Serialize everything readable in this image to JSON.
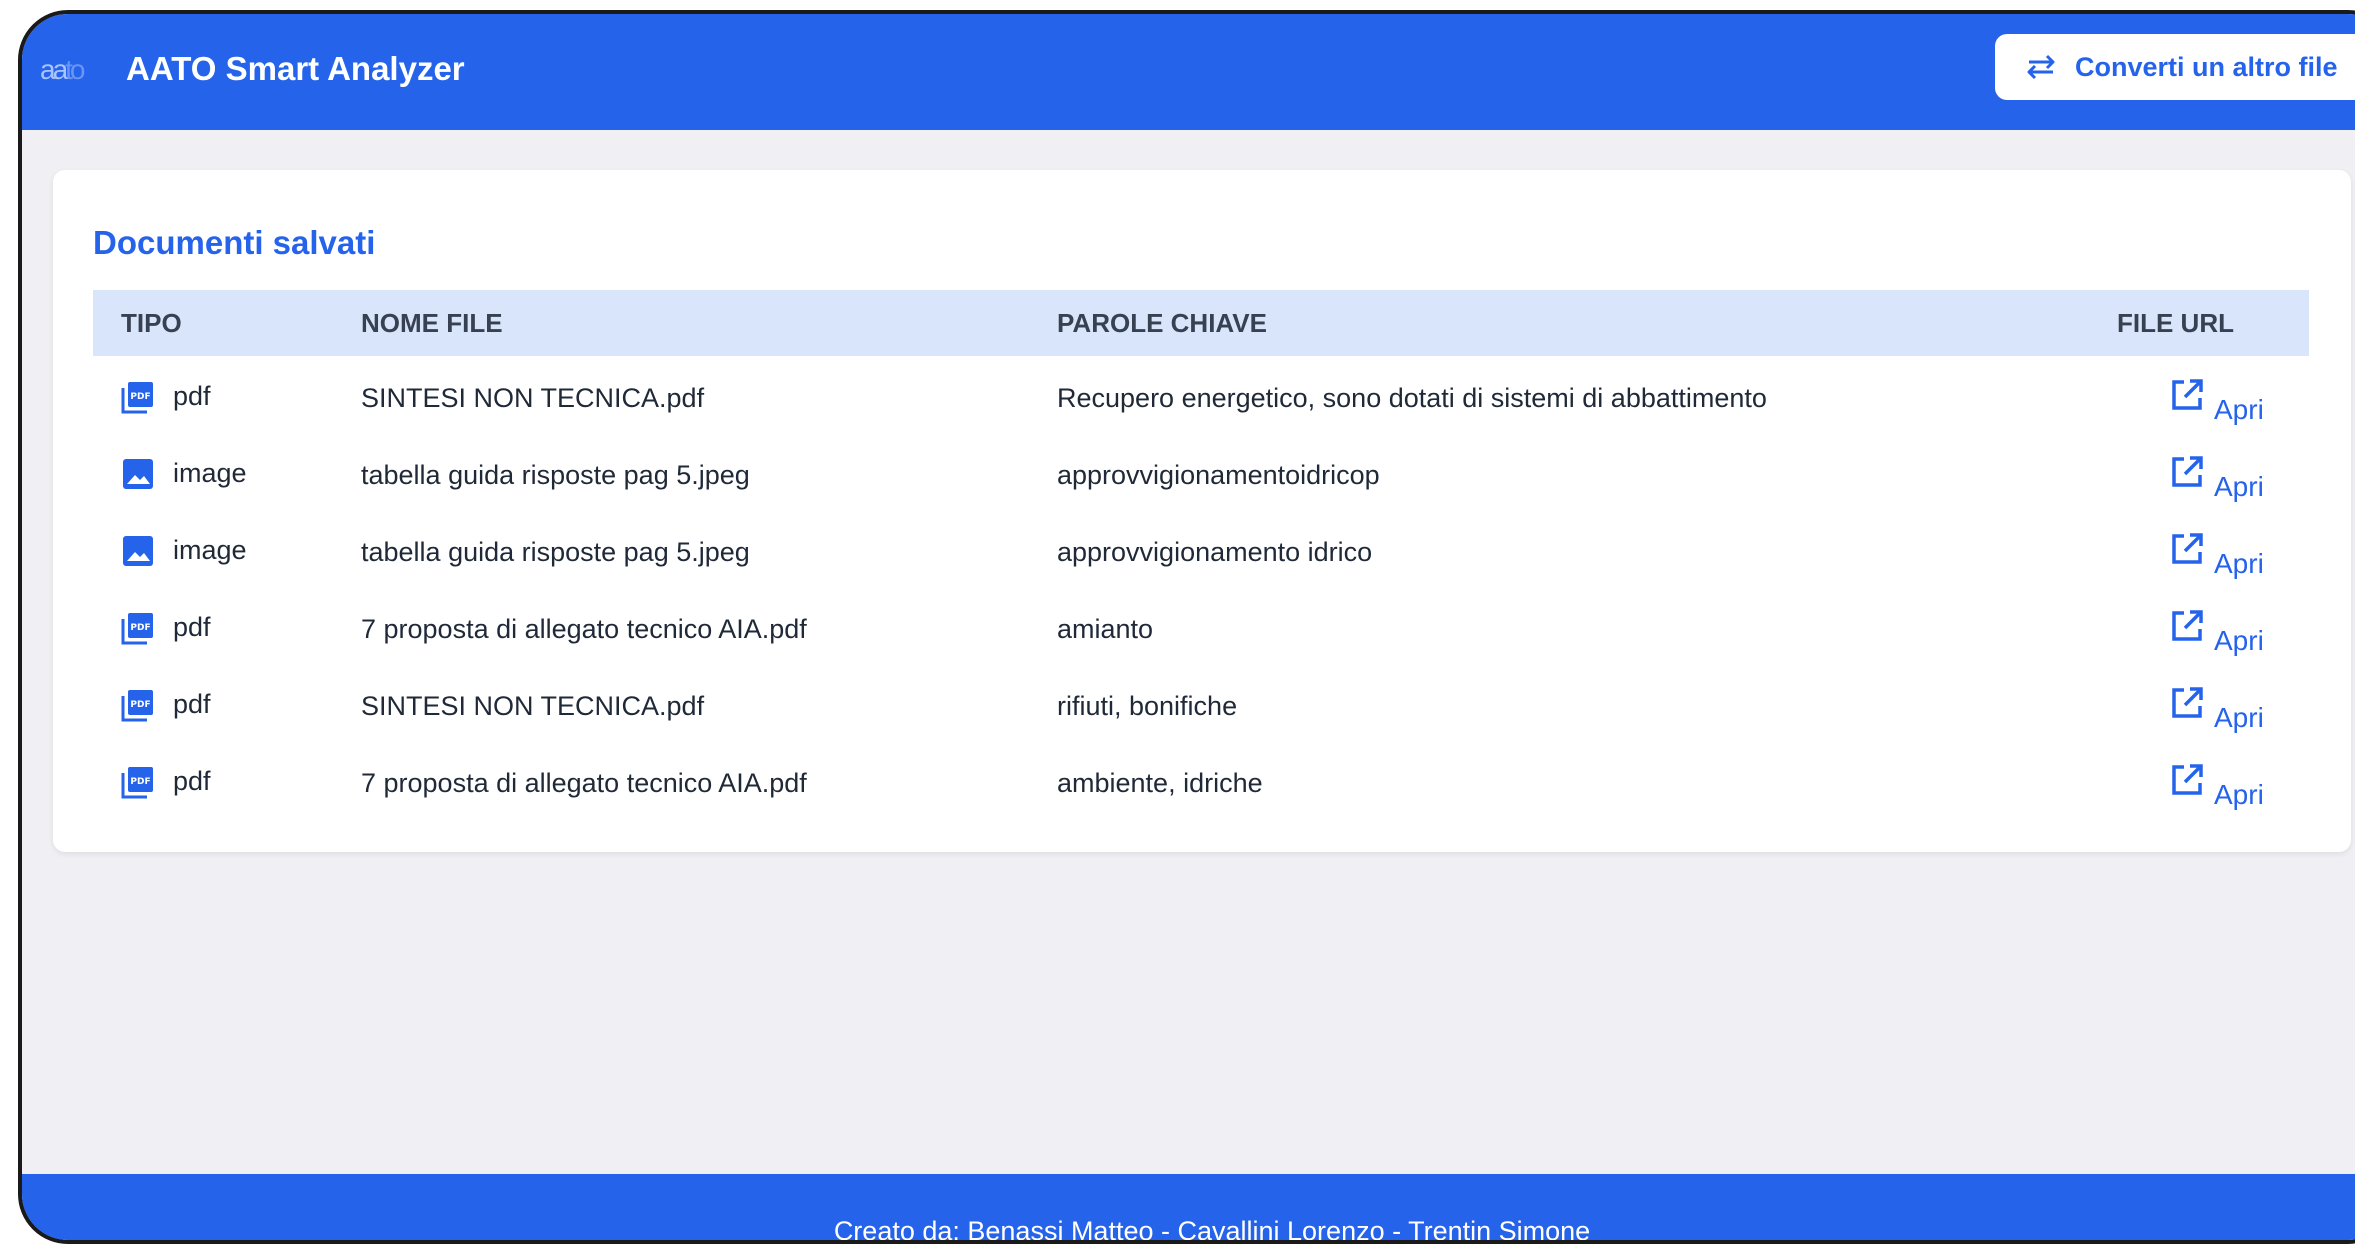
{
  "header": {
    "logo_text_1": "aa",
    "logo_text_2": "to",
    "app_title": "AATO Smart Analyzer",
    "convert_button_label": "Converti un altro file",
    "background_color": "#2563eb"
  },
  "documents": {
    "title": "Documenti salvati",
    "columns": {
      "type": "TIPO",
      "file_name": "NOME FILE",
      "keywords": "PAROLE CHIAVE",
      "file_url": "FILE URL"
    },
    "rows": [
      {
        "type": "pdf",
        "icon": "pdf-icon",
        "file_name": "SINTESI NON TECNICA.pdf",
        "keywords": "Recupero energetico, sono dotati di sistemi di abbattimento",
        "link_label": "Apri"
      },
      {
        "type": "image",
        "icon": "image-icon",
        "file_name": "tabella guida risposte pag 5.jpeg",
        "keywords": "approvvigionamentoidricop",
        "link_label": "Apri"
      },
      {
        "type": "image",
        "icon": "image-icon",
        "file_name": "tabella guida risposte pag 5.jpeg",
        "keywords": "approvvigionamento idrico",
        "link_label": "Apri"
      },
      {
        "type": "pdf",
        "icon": "pdf-icon",
        "file_name": "7 proposta di allegato tecnico AIA.pdf",
        "keywords": "amianto",
        "link_label": "Apri"
      },
      {
        "type": "pdf",
        "icon": "pdf-icon",
        "file_name": "SINTESI NON TECNICA.pdf",
        "keywords": "rifiuti, bonifiche",
        "link_label": "Apri"
      },
      {
        "type": "pdf",
        "icon": "pdf-icon",
        "file_name": "7 proposta di allegato tecnico AIA.pdf",
        "keywords": "ambiente, idriche",
        "link_label": "Apri"
      }
    ]
  },
  "footer": {
    "credits": "Creato da: Benassi Matteo - Cavallini Lorenzo - Trentin Simone"
  },
  "colors": {
    "accent": "#2563eb",
    "table_header": "#d8e5fb",
    "page_background": "#f0f0f4"
  }
}
